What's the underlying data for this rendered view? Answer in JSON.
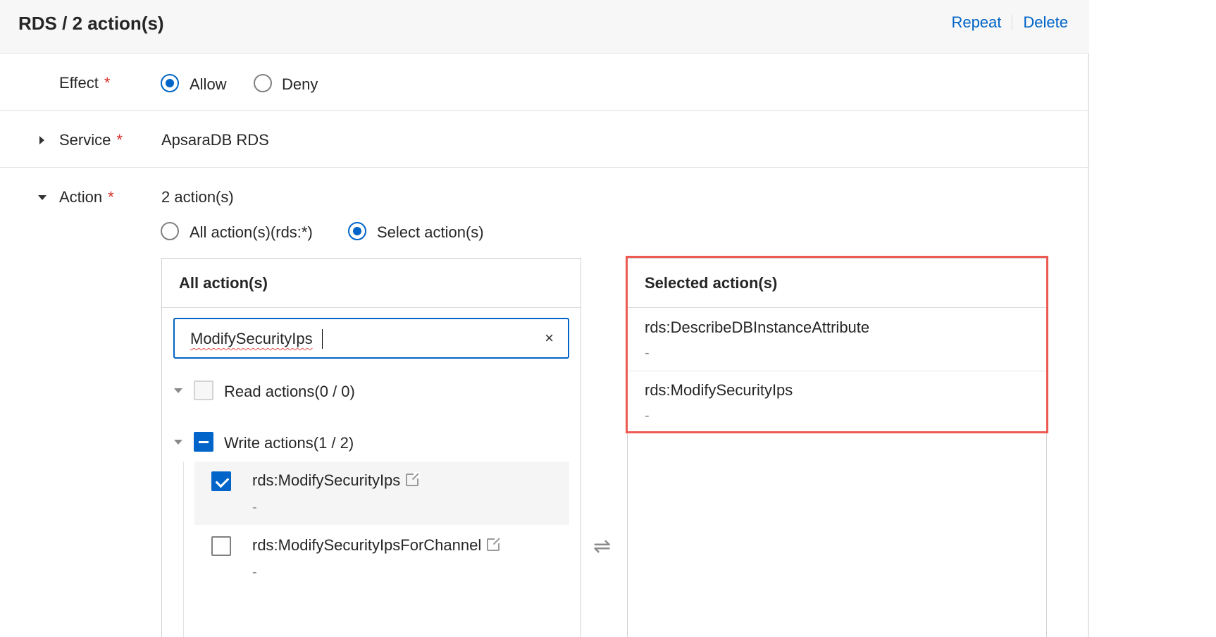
{
  "header": {
    "title": "RDS / 2 action(s)",
    "repeat_label": "Repeat",
    "delete_label": "Delete"
  },
  "effect": {
    "label": "Effect",
    "required_mark": "*",
    "options": [
      {
        "label": "Allow",
        "selected": true
      },
      {
        "label": "Deny",
        "selected": false
      }
    ]
  },
  "service": {
    "label": "Service",
    "required_mark": "*",
    "value": "ApsaraDB RDS"
  },
  "action": {
    "label": "Action",
    "required_mark": "*",
    "summary": "2 action(s)",
    "mode_options": [
      {
        "label": "All action(s)(rds:*)",
        "selected": false
      },
      {
        "label": "Select action(s)",
        "selected": true
      }
    ]
  },
  "all_actions": {
    "title": "All action(s)",
    "search_value": "ModifySecurityIps",
    "groups": [
      {
        "label": "Read actions(0 / 0)",
        "state": "disabled"
      },
      {
        "label": "Write actions(1 / 2)",
        "state": "partial"
      }
    ],
    "items": [
      {
        "name": "rds:ModifySecurityIps",
        "desc": "-",
        "checked": true
      },
      {
        "name": "rds:ModifySecurityIpsForChannel",
        "desc": "-",
        "checked": false
      }
    ]
  },
  "selected_actions": {
    "title": "Selected action(s)",
    "items": [
      {
        "name": "rds:DescribeDBInstanceAttribute",
        "desc": "-"
      },
      {
        "name": "rds:ModifySecurityIps",
        "desc": "-"
      }
    ]
  },
  "colors": {
    "accent": "#0064c8",
    "required": "#d93026",
    "highlight": "#ec5a52"
  }
}
